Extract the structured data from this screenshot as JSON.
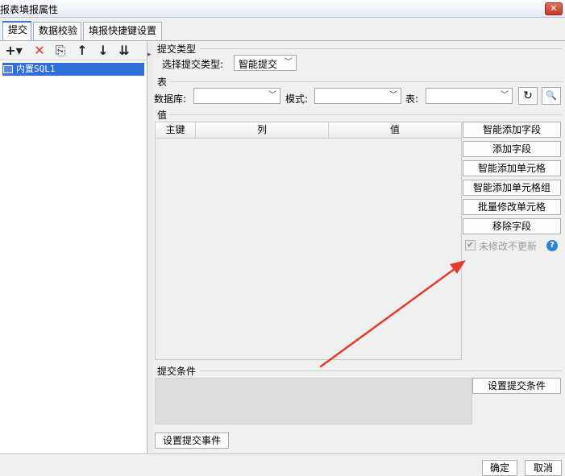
{
  "window": {
    "title": "报表填报属性",
    "close_glyph": "✕"
  },
  "tabs": [
    {
      "label": "提交",
      "active": true
    },
    {
      "label": "数据校验",
      "active": false
    },
    {
      "label": "填报快捷键设置",
      "active": false
    }
  ],
  "left_toolbar": {
    "add": "+▾",
    "delete": "✕",
    "copy": "⎘",
    "up": "↑",
    "down": "↓",
    "sort": "⇊"
  },
  "tree": {
    "items": [
      {
        "label": "内置SQL1",
        "icon": "database-icon"
      }
    ]
  },
  "submit_type": {
    "section": "提交类型",
    "label": "选择提交类型:",
    "value": "智能提交"
  },
  "table_section": {
    "section": "表",
    "database_label": "数据库:",
    "schema_label": "模式:",
    "table_label": "表:",
    "database_value": "",
    "schema_value": "",
    "table_value": "",
    "refresh_icon": "↻",
    "preview_icon": "🔍"
  },
  "value_section": {
    "section": "值",
    "columns": [
      "主键",
      "列",
      "值"
    ],
    "rows": [],
    "buttons": [
      "智能添加字段",
      "添加字段",
      "智能添加单元格",
      "智能添加单元格组",
      "批量修改单元格",
      "移除字段"
    ],
    "checkbox_label": "未修改不更新",
    "checkbox_checked": true,
    "help_glyph": "?"
  },
  "condition_section": {
    "section": "提交条件",
    "set_condition_button": "设置提交条件"
  },
  "event_button": "设置提交事件",
  "dialog_buttons": {
    "ok": "确定",
    "cancel": "取消"
  },
  "colors": {
    "accent": "#2f6fd6",
    "annotation_arrow": "#e53a2a"
  }
}
